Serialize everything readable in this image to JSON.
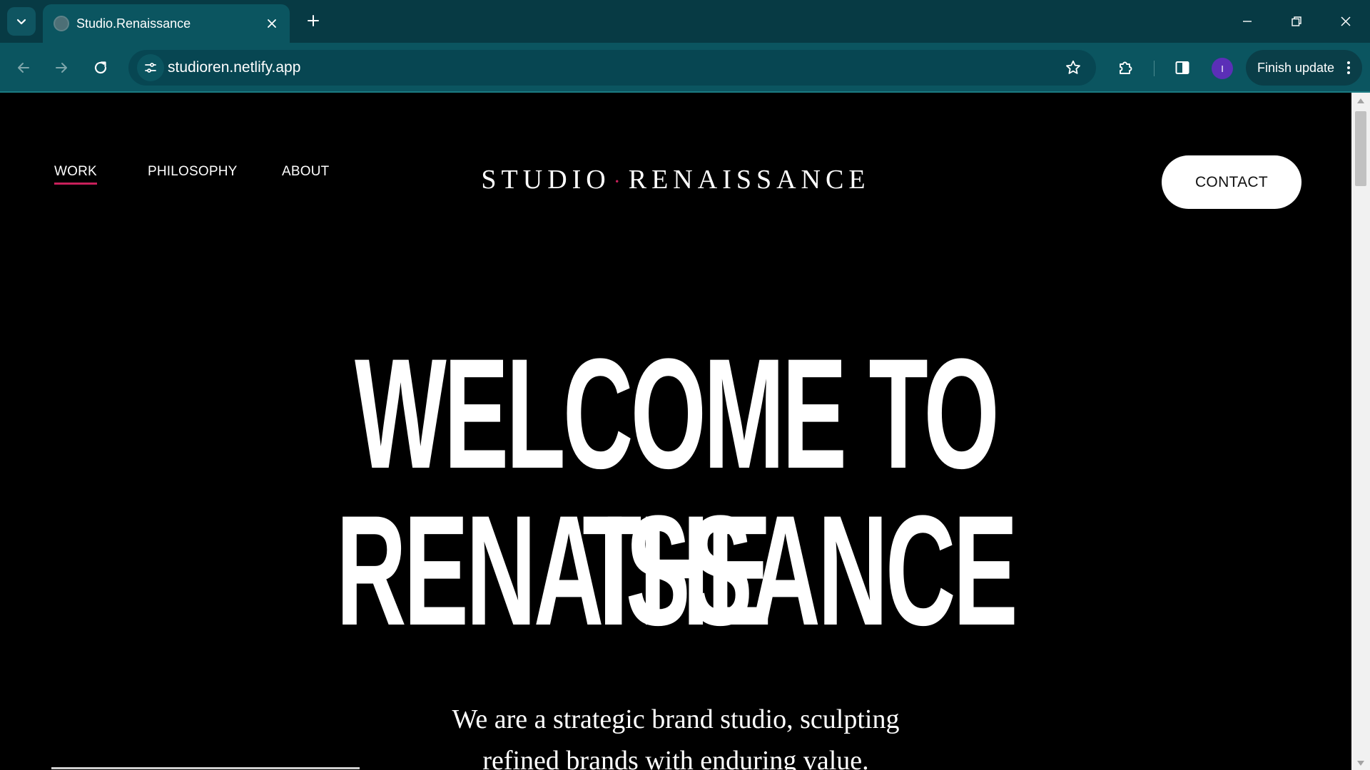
{
  "browser": {
    "tab_title": "Studio.Renaissance",
    "url": "studioren.netlify.app",
    "profile_initial": "I",
    "finish_update_label": "Finish update"
  },
  "icons": {
    "tab_list": "chevron-down-icon",
    "tab_close": "close-icon",
    "new_tab": "plus-icon",
    "minimize": "minimize-icon",
    "restore": "restore-icon",
    "close_window": "close-icon",
    "back": "arrow-left-icon",
    "forward": "arrow-right-icon",
    "reload": "reload-icon",
    "site_info": "tune-icon",
    "bookmark": "star-icon",
    "extensions": "puzzle-icon",
    "side_panel": "side-panel-icon",
    "menu": "kebab-menu-icon"
  },
  "site": {
    "nav": {
      "work": "WORK",
      "philosophy": "PHILOSOPHY",
      "about": "ABOUT"
    },
    "logo": {
      "left": "STUDIO",
      "dot": "·",
      "right": "RENAISSANCE"
    },
    "contact_label": "CONTACT",
    "hero": {
      "line1": "WELCOME TO THE",
      "line2": "RENAISSANCE"
    },
    "tagline": {
      "line1": "We are a strategic brand studio, sculpting",
      "line2": "refined brands with enduring value."
    },
    "accent_color": "#c8205a"
  }
}
